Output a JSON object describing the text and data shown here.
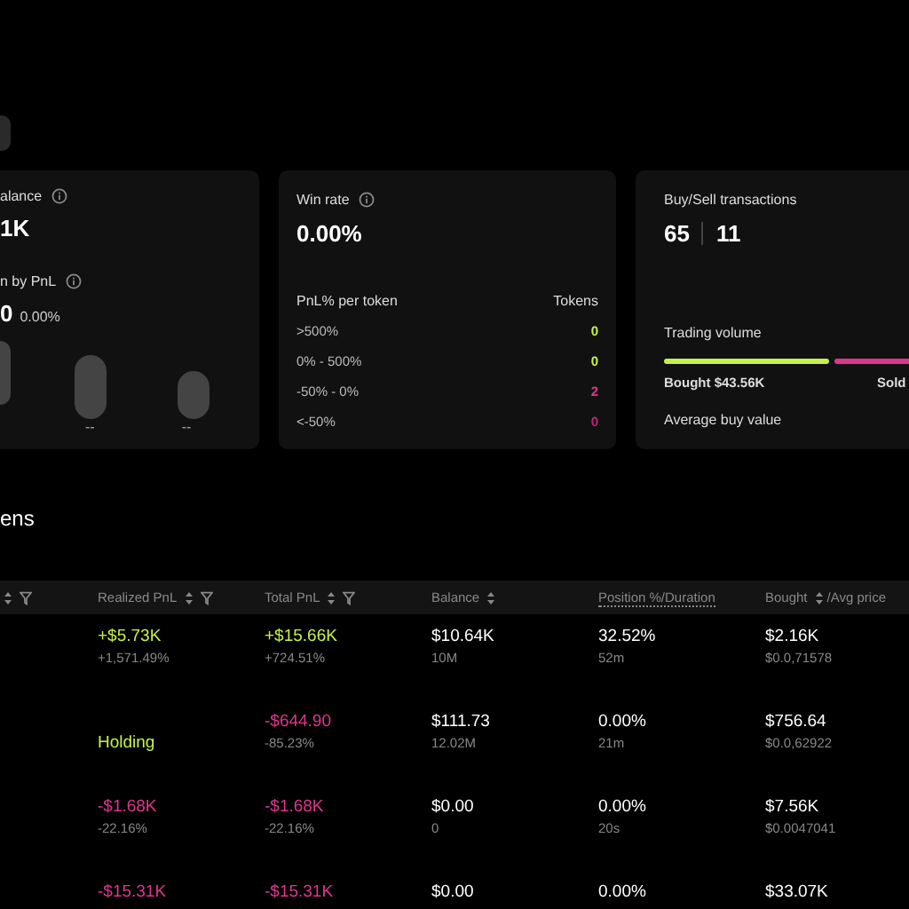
{
  "balance_card": {
    "label": "alance",
    "value": "1K",
    "pnl_label": "n by PnL",
    "pnl_value": "0",
    "pnl_percent": "0.00%",
    "bar_labels": [
      "--",
      "--"
    ]
  },
  "winrate_card": {
    "label": "Win rate",
    "value": "0.00%",
    "table_heading": "PnL% per token",
    "count_heading": "Tokens",
    "rows": [
      {
        "range": ">500%",
        "count": "0",
        "color": "#c6f04a"
      },
      {
        "range": "0% - 500%",
        "count": "0",
        "color": "#c6f04a"
      },
      {
        "range": "-50% - 0%",
        "count": "2",
        "color": "#e0358f"
      },
      {
        "range": "<-50%",
        "count": "0",
        "color": "#b02a72"
      }
    ]
  },
  "transactions_card": {
    "label": "Buy/Sell transactions",
    "buys": "65",
    "sells": "11",
    "volume_label": "Trading volume",
    "bought": "Bought $43.56K",
    "sold": "Sold",
    "avg_label": "Average buy value"
  },
  "section_title": "ens",
  "table": {
    "lead_column": {
      "sortable": true,
      "filter": true
    },
    "columns": [
      {
        "label": "Realized PnL",
        "sortable": true,
        "filter": true
      },
      {
        "label": "Total PnL",
        "sortable": true,
        "filter": true
      },
      {
        "label": "Balance",
        "sortable": true,
        "filter": false
      },
      {
        "label": "Position %/Duration",
        "sortable": false,
        "filter": false,
        "dotted": true
      },
      {
        "label": "Bought",
        "sortable": true,
        "filter": false,
        "suffix": "/Avg price"
      }
    ],
    "rows": [
      {
        "cells": [
          {
            "main": "+$5.73K",
            "sub": "+1,571.49%",
            "color": "#c6f04a"
          },
          {
            "main": "+$15.66K",
            "sub": "+724.51%",
            "color": "#c6f04a"
          },
          {
            "main": "$10.64K",
            "sub": "10M"
          },
          {
            "main": "32.52%",
            "sub": "52m"
          },
          {
            "main": "$2.16K",
            "sub": "$0.0,71578"
          }
        ]
      },
      {
        "cells": [
          {
            "main": "Holding",
            "color": "#c6f04a"
          },
          {
            "main": "-$644.90",
            "sub": "-85.23%",
            "color": "#e0358f"
          },
          {
            "main": "$111.73",
            "sub": "12.02M"
          },
          {
            "main": "0.00%",
            "sub": "21m"
          },
          {
            "main": "$756.64",
            "sub": "$0.0,62922"
          }
        ]
      },
      {
        "cells": [
          {
            "main": "-$1.68K",
            "sub": "-22.16%",
            "color": "#e0358f"
          },
          {
            "main": "-$1.68K",
            "sub": "-22.16%",
            "color": "#e0358f"
          },
          {
            "main": "$0.00",
            "sub": "0"
          },
          {
            "main": "0.00%",
            "sub": "20s"
          },
          {
            "main": "$7.56K",
            "sub": "$0.0047041"
          }
        ]
      },
      {
        "cells": [
          {
            "main": "-$15.31K",
            "color": "#e0358f"
          },
          {
            "main": "-$15.31K",
            "color": "#e0358f"
          },
          {
            "main": "$0.00"
          },
          {
            "main": "0.00%"
          },
          {
            "main": "$33.07K"
          }
        ]
      }
    ]
  }
}
